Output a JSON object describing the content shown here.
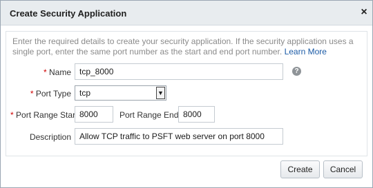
{
  "dialog": {
    "title": "Create Security Application",
    "close_glyph": "×",
    "instructions": "Enter the required details to create your security application. If the security application uses a single port, enter the same port number as the start and end port number.",
    "learn_more": "Learn More"
  },
  "form": {
    "required_mark": "*",
    "name": {
      "label": "Name",
      "value": "tcp_8000"
    },
    "port_type": {
      "label": "Port Type",
      "value": "tcp"
    },
    "port_range_start": {
      "label": "Port Range Start",
      "value": "8000"
    },
    "port_range_end": {
      "label": "Port Range End",
      "value": "8000"
    },
    "description": {
      "label": "Description",
      "value": "Allow TCP traffic to PSFT web server on port 8000"
    },
    "help_glyph": "?"
  },
  "buttons": {
    "create": "Create",
    "cancel": "Cancel"
  },
  "icons": {
    "close": "close-icon",
    "help": "help-icon",
    "dropdown": "chevron-down-icon"
  },
  "colors": {
    "required": "#d00000",
    "link": "#1a5aa6",
    "titlebar_bg": "#e8ecef"
  }
}
